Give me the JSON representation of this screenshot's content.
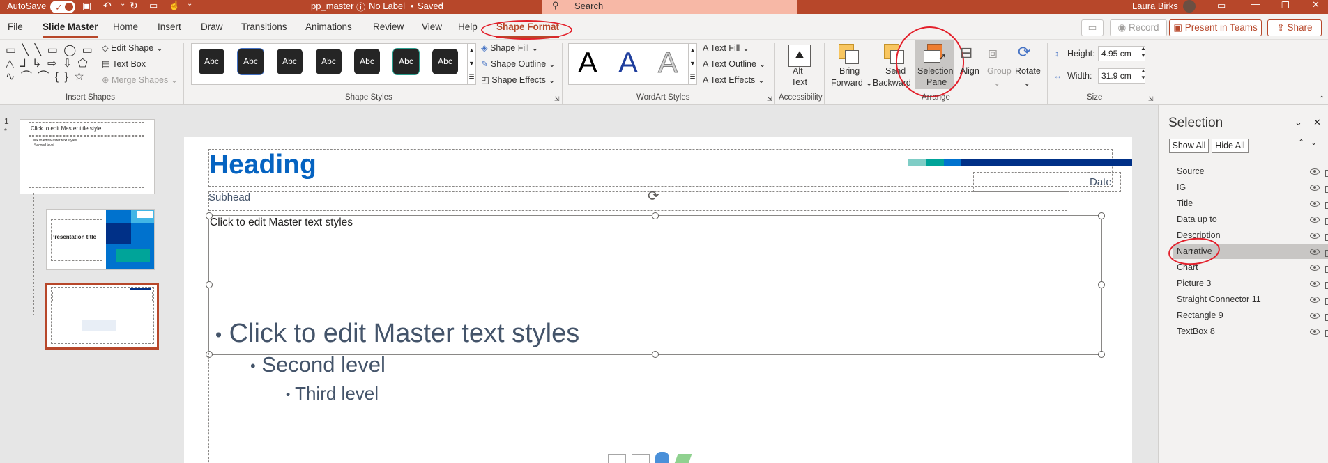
{
  "titlebar": {
    "autosave_label": "AutoSave",
    "toggle_state": "On",
    "filename": "pp_master",
    "label_status": "No Label",
    "save_status": "Saved",
    "search_placeholder": "Search",
    "user_name": "Laura Birks"
  },
  "tabs": [
    {
      "label": "File"
    },
    {
      "label": "Slide Master"
    },
    {
      "label": "Home"
    },
    {
      "label": "Insert"
    },
    {
      "label": "Draw"
    },
    {
      "label": "Transitions"
    },
    {
      "label": "Animations"
    },
    {
      "label": "Review"
    },
    {
      "label": "View"
    },
    {
      "label": "Help"
    },
    {
      "label": "Shape Format"
    }
  ],
  "top_actions": {
    "record_label": "Record",
    "present_label": "Present in Teams",
    "share_label": "Share"
  },
  "ribbon": {
    "insert_shapes": {
      "edit_shape": "Edit Shape",
      "text_box": "Text Box",
      "merge_shapes": "Merge Shapes",
      "group_label": "Insert Shapes"
    },
    "shape_styles": {
      "swatch_text": "Abc",
      "shape_fill": "Shape Fill",
      "shape_outline": "Shape Outline",
      "shape_effects": "Shape Effects",
      "group_label": "Shape Styles"
    },
    "wordart": {
      "letter": "A",
      "text_fill": "Text Fill",
      "text_outline": "Text Outline",
      "text_effects": "Text Effects",
      "group_label": "WordArt Styles"
    },
    "accessibility": {
      "alt_text_1": "Alt",
      "alt_text_2": "Text",
      "group_label": "Accessibility"
    },
    "arrange": {
      "bring_forward_1": "Bring",
      "bring_forward_2": "Forward",
      "send_backward_1": "Send",
      "send_backward_2": "Backward",
      "selection_pane_1": "Selection",
      "selection_pane_2": "Pane",
      "align": "Align",
      "group": "Group",
      "rotate": "Rotate",
      "group_label": "Arrange"
    },
    "size": {
      "height_label": "Height:",
      "height_value": "4.95 cm",
      "width_label": "Width:",
      "width_value": "31.9 cm",
      "group_label": "Size"
    }
  },
  "thumbnails": {
    "slide_number": "1",
    "master_title": "Click to edit Master title style",
    "master_text": "Click to edit Master text styles",
    "second_level": "Second level",
    "layout1_title": "Presentation title"
  },
  "slide": {
    "heading": "Heading",
    "date": "Date",
    "subhead": "Subhead",
    "narrative_text": "Click to edit Master text styles",
    "body_level1": "Click to edit Master text styles",
    "body_level2": "Second level",
    "body_level3": "Third level",
    "bullet": "•"
  },
  "selection_pane": {
    "title": "Selection",
    "show_all": "Show All",
    "hide_all": "Hide All",
    "items": [
      {
        "name": "Source"
      },
      {
        "name": "IG"
      },
      {
        "name": "Title"
      },
      {
        "name": "Data up to"
      },
      {
        "name": "Description"
      },
      {
        "name": "Narrative"
      },
      {
        "name": "Chart"
      },
      {
        "name": "Picture 3"
      },
      {
        "name": "Straight Connector 11"
      },
      {
        "name": "Rectangle 9"
      },
      {
        "name": "TextBox 8"
      }
    ],
    "selected_item": "Narrative"
  },
  "colors": {
    "accent": "#b7472a",
    "heading_blue": "#0563c1",
    "annotation_red": "#e3202b",
    "slide_text": "#44546a"
  }
}
